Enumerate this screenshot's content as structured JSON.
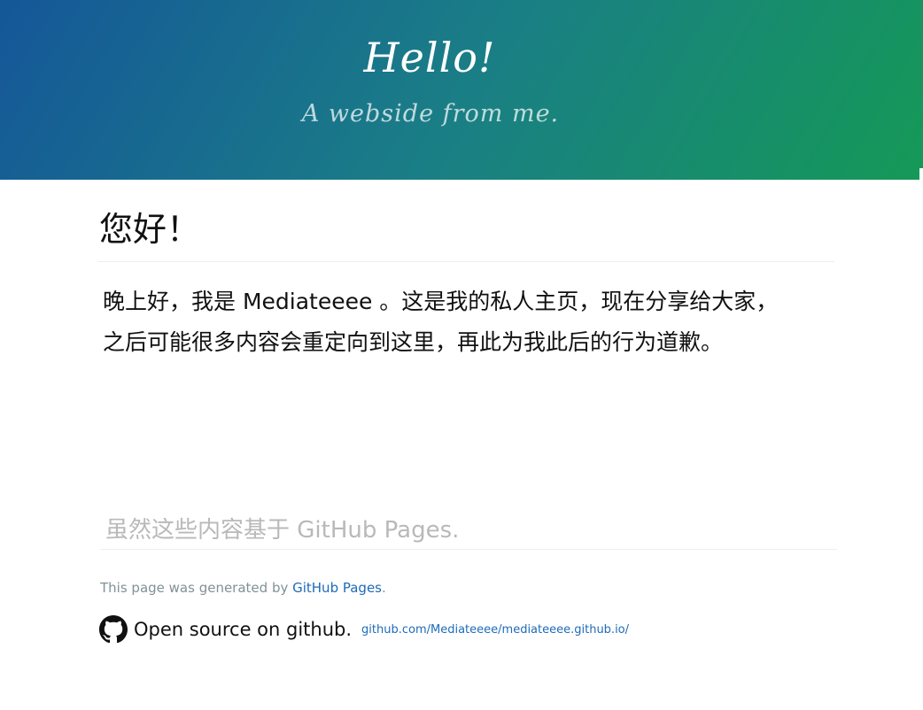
{
  "header": {
    "title": "Hello!",
    "tagline": "A webside from me."
  },
  "main": {
    "heading": "您好！",
    "intro_line1": "晚上好，我是 Mediateeee 。这是我的私人主页，现在分享给大家，",
    "intro_line2": "之后可能很多内容会重定向到这里，再此为我此后的行为道歉。",
    "note": "虽然这些内容基于 GitHub Pages."
  },
  "footer": {
    "generated_prefix": "This page was generated by ",
    "generated_link": "GitHub Pages",
    "generated_suffix": ".",
    "github_icon": "github-icon",
    "open_source_label": "Open source on github.",
    "repo_link": "github.com/Mediateeee/mediateeee.github.io/"
  },
  "colors": {
    "gradient_start": "#155799",
    "gradient_end": "#159957",
    "link": "#1e6bb8",
    "muted": "#819198"
  }
}
